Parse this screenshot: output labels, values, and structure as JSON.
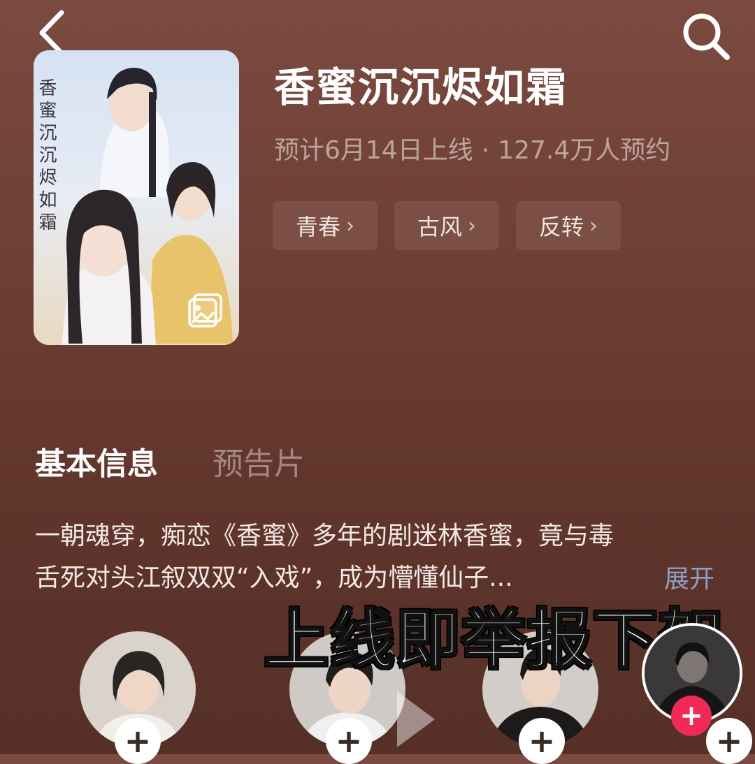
{
  "header": {
    "back_icon": "chevron-left-icon",
    "search_icon": "search-icon"
  },
  "drama": {
    "title": "香蜜沉沉烬如霜",
    "release": "预计6月14日上线",
    "separator": "·",
    "reservations": "127.4万人预约",
    "poster_text": "香蜜沉沉烬如霜",
    "tags": [
      {
        "label": "青春"
      },
      {
        "label": "古风"
      },
      {
        "label": "反转"
      }
    ]
  },
  "tabs": [
    {
      "label": "基本信息",
      "active": true
    },
    {
      "label": "预告片",
      "active": false
    }
  ],
  "synopsis": {
    "line1": "一朝魂穿，痴恋《香蜜》多年的剧迷林香蜜，竟与毒",
    "line2": "舌死对头江叙双双“入戏”，成为懵懂仙子...",
    "expand": "展开"
  },
  "overlay_caption": "上线即举报下架",
  "cast": [
    {
      "icon": "avatar"
    },
    {
      "icon": "avatar"
    },
    {
      "icon": "avatar"
    }
  ],
  "follow_icon": "plus-icon",
  "colors": {
    "background": "#6e3f34",
    "accent_follow": "#ef2b55",
    "expand_link": "#8e9fc4",
    "muted_text": "#bca59d"
  }
}
